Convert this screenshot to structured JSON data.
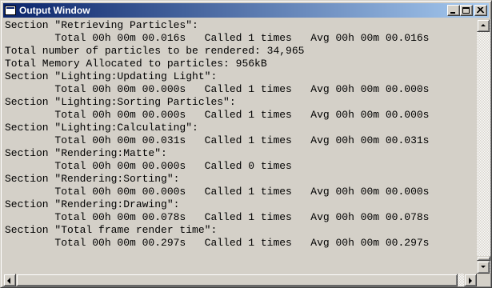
{
  "window": {
    "title": "Output Window",
    "icon": "window-icon",
    "buttons": {
      "minimize": "minimize-icon",
      "maximize": "maximize-icon",
      "close": "close-icon"
    }
  },
  "output": {
    "lines": [
      "Section \"Retrieving Particles\":",
      "        Total 00h 00m 00.016s   Called 1 times   Avg 00h 00m 00.016s",
      "Total number of particles to be rendered: 34,965",
      "Total Memory Allocated to particles: 956kB",
      "Section \"Lighting:Updating Light\":",
      "        Total 00h 00m 00.000s   Called 1 times   Avg 00h 00m 00.000s",
      "Section \"Lighting:Sorting Particles\":",
      "        Total 00h 00m 00.000s   Called 1 times   Avg 00h 00m 00.000s",
      "Section \"Lighting:Calculating\":",
      "        Total 00h 00m 00.031s   Called 1 times   Avg 00h 00m 00.031s",
      "Section \"Rendering:Matte\":",
      "        Total 00h 00m 00.000s   Called 0 times",
      "Section \"Rendering:Sorting\":",
      "        Total 00h 00m 00.000s   Called 1 times   Avg 00h 00m 00.000s",
      "Section \"Rendering:Drawing\":",
      "        Total 00h 00m 00.078s   Called 1 times   Avg 00h 00m 00.078s",
      "Section \"Total frame render time\":",
      "        Total 00h 00m 00.297s   Called 1 times   Avg 00h 00m 00.297s"
    ]
  },
  "scrollbars": {
    "vertical": {
      "up_icon": "arrow-up-icon",
      "down_icon": "arrow-down-icon",
      "position": 1.0
    },
    "horizontal": {
      "left_icon": "arrow-left-icon",
      "right_icon": "arrow-right-icon",
      "position": 0.0
    }
  },
  "colors": {
    "titlebar_start": "#0a246a",
    "titlebar_end": "#a6caf0",
    "face": "#d4d0c8"
  }
}
